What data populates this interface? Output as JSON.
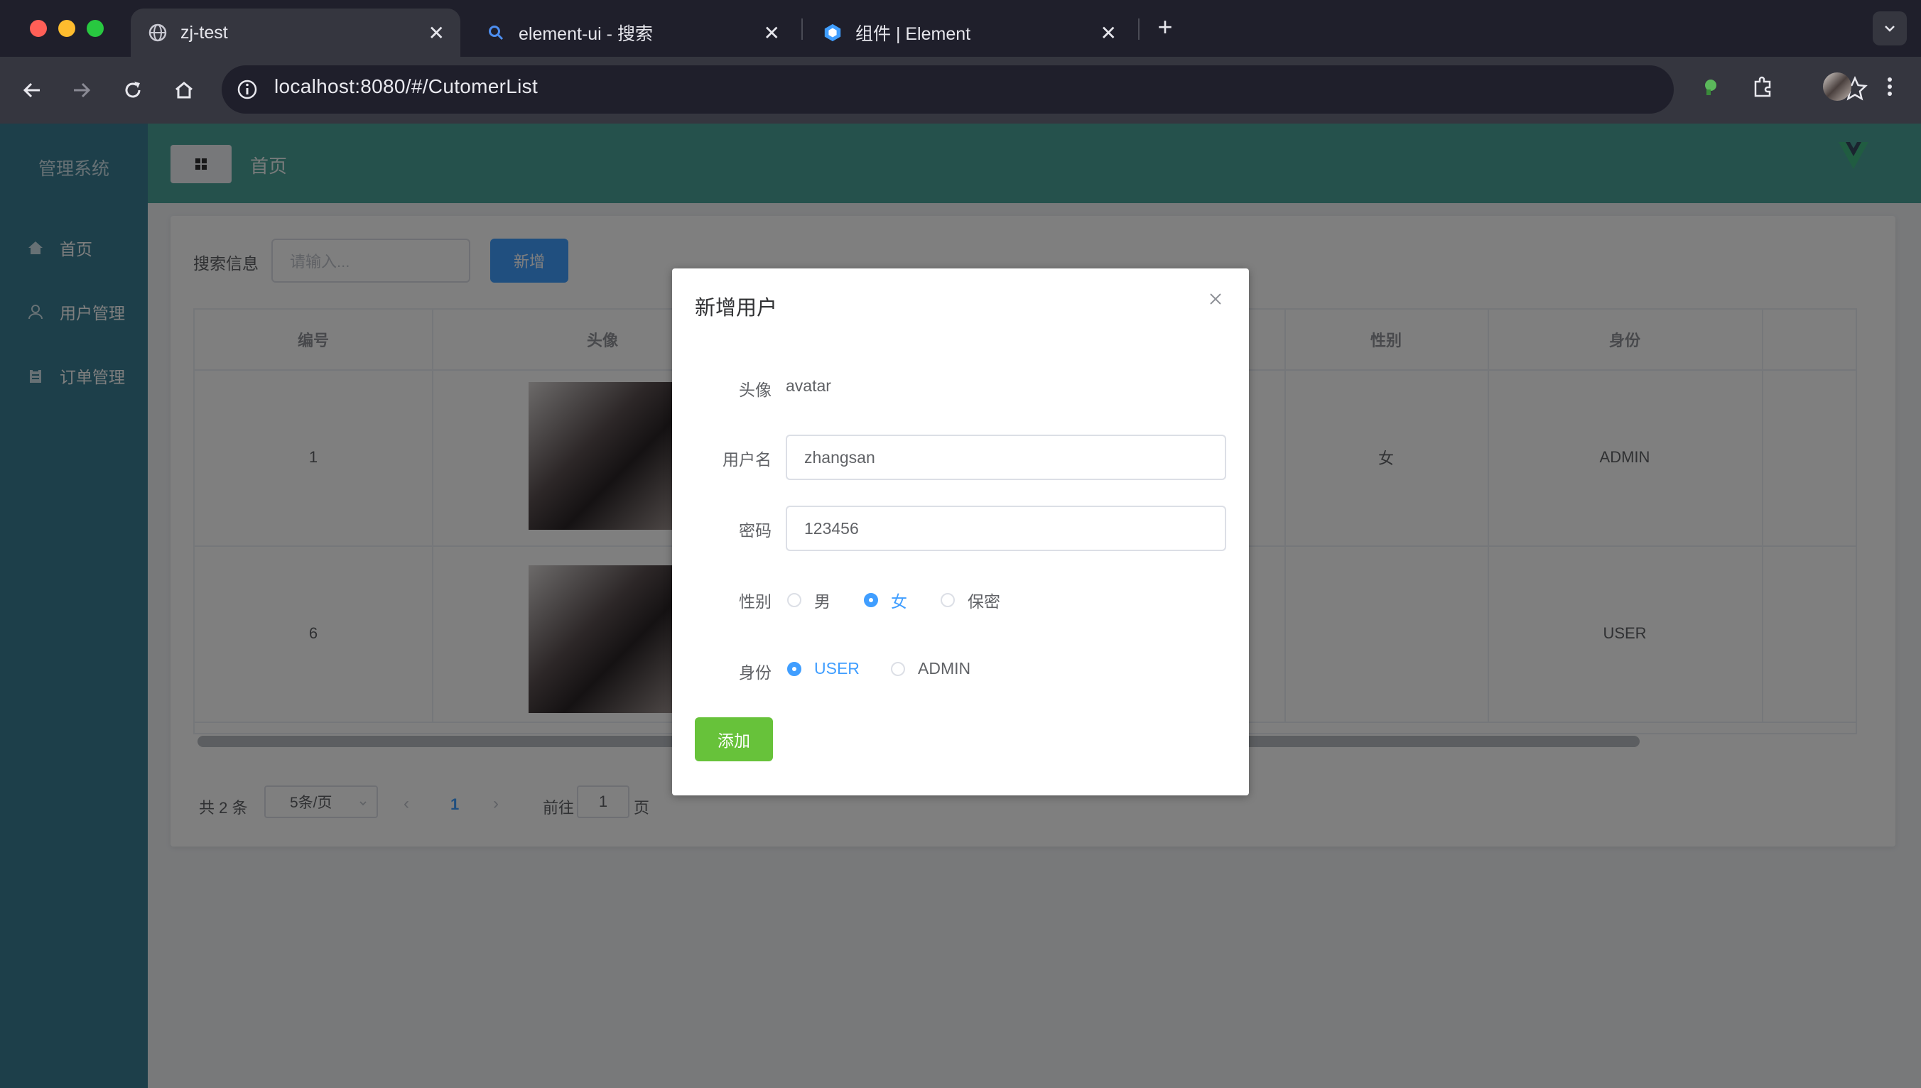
{
  "browser": {
    "tabs": [
      {
        "title": "zj-test",
        "icon": "globe-icon",
        "active": true
      },
      {
        "title": "element-ui - 搜索",
        "icon": "search-icon",
        "active": false
      },
      {
        "title": "组件 | Element",
        "icon": "element-logo-icon",
        "active": false
      }
    ],
    "url": "localhost:8080/#/CutomerList",
    "colors": {
      "chrome_bg": "#1f1f2b",
      "toolbar_bg": "#35363f"
    }
  },
  "app": {
    "title": "管理系统",
    "menu": [
      {
        "label": "首页",
        "icon": "home-icon"
      },
      {
        "label": "用户管理",
        "icon": "user-icon"
      },
      {
        "label": "订单管理",
        "icon": "clipboard-icon"
      }
    ],
    "breadcrumb": "首页",
    "colors": {
      "sidebar": "#3a7f94",
      "header": "#4aa399",
      "primary": "#409eff",
      "success": "#67c23a"
    }
  },
  "search": {
    "label": "搜索信息",
    "placeholder": "请输入...",
    "add_button": "新增"
  },
  "table": {
    "columns": {
      "id": "编号",
      "avatar": "头像",
      "gender": "性别",
      "role": "身份"
    },
    "rows": [
      {
        "id": "1",
        "gender": "女",
        "role": "ADMIN"
      },
      {
        "id": "6",
        "gender": "",
        "role": "USER"
      }
    ]
  },
  "pagination": {
    "total": "共 2 条",
    "page_size": "5条/页",
    "current_page": "1",
    "goto_label": "前往",
    "goto_value": "1",
    "goto_unit": "页"
  },
  "dialog": {
    "title": "新增用户",
    "avatar_label": "头像",
    "avatar_value": "avatar",
    "username_label": "用户名",
    "username_value": "zhangsan",
    "password_label": "密码",
    "password_value": "123456",
    "gender_label": "性别",
    "gender_options": [
      "男",
      "女",
      "保密"
    ],
    "gender_selected": "女",
    "role_label": "身份",
    "role_options": [
      "USER",
      "ADMIN"
    ],
    "role_selected": "USER",
    "submit": "添加"
  }
}
